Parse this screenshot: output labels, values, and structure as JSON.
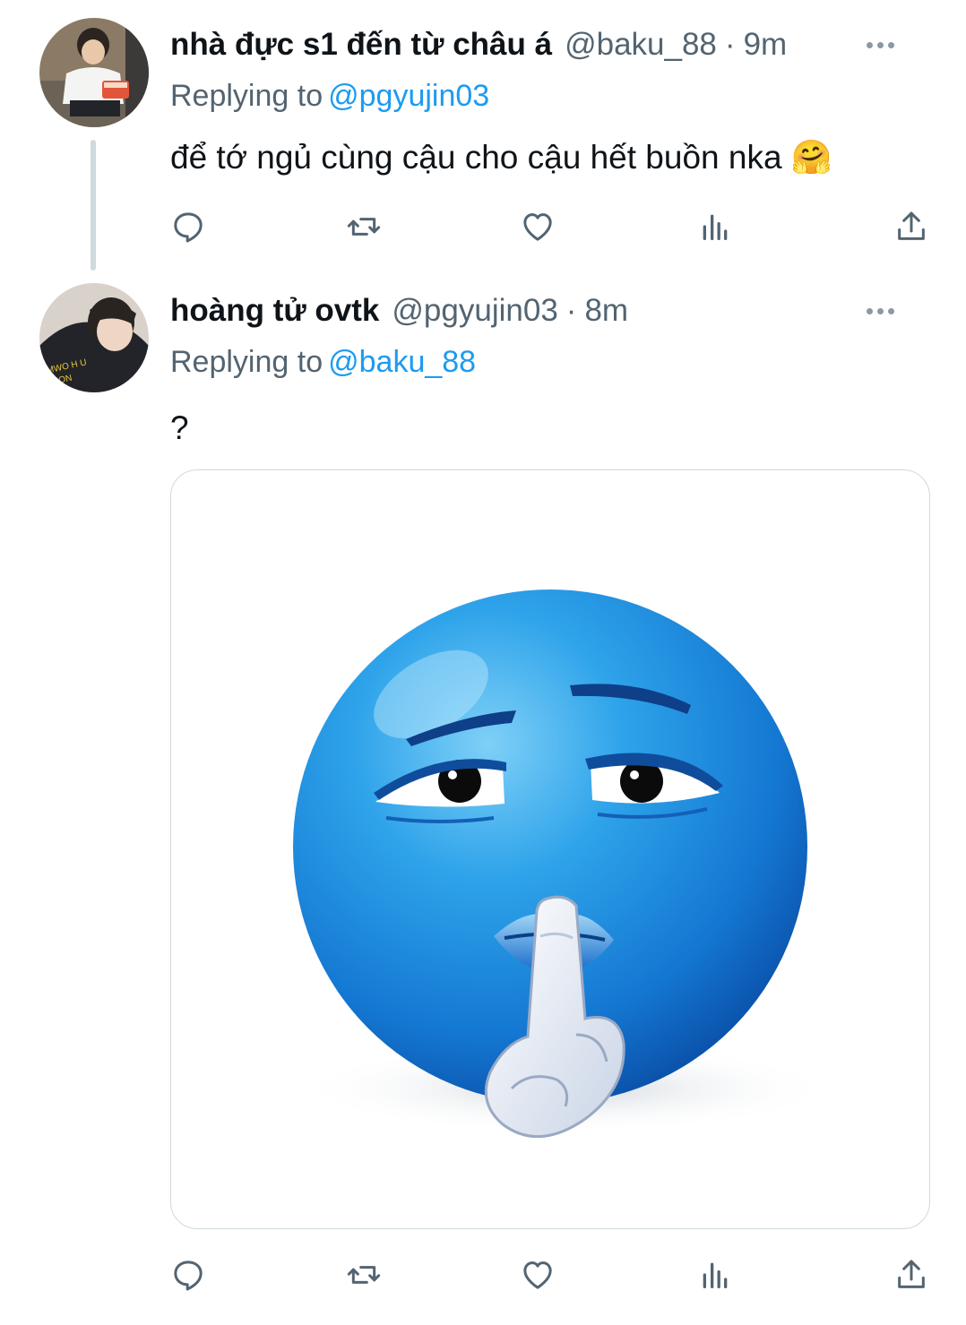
{
  "tweets": [
    {
      "name": "nhà đực s1 đến từ châu á",
      "handle": "@baku_88",
      "separator": "·",
      "time": "9m",
      "replying_prefix": "Replying to",
      "replying_to": "@pgyujin03",
      "text": "để tớ ngủ cùng cậu cho cậu hết buồn nka",
      "emoji": "🤗",
      "icons": [
        "reply-icon",
        "retweet-icon",
        "like-icon",
        "analytics-icon",
        "share-icon"
      ]
    },
    {
      "name": "hoàng tử ovtk",
      "handle": "@pgyujin03",
      "separator": "·",
      "time": "8m",
      "replying_prefix": "Replying to",
      "replying_to": "@baku_88",
      "text": "?",
      "media": "blue shushing smiley face",
      "icons": [
        "reply-icon",
        "retweet-icon",
        "like-icon",
        "analytics-icon",
        "share-icon"
      ]
    }
  ],
  "colors": {
    "text": "#0f1419",
    "secondary": "#536471",
    "link": "#1d9bf0",
    "border": "#cfd9de",
    "emoji_blue": "#1f8fe0"
  }
}
